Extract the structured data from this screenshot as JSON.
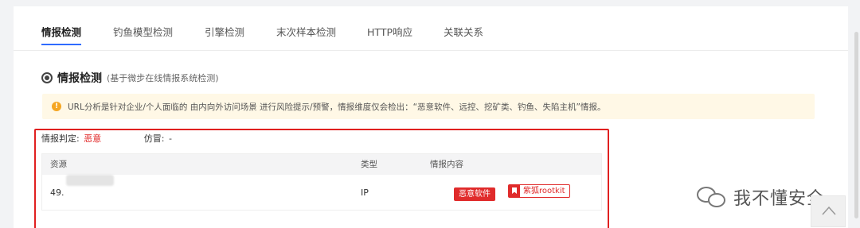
{
  "tabs": [
    "情报检测",
    "钓鱼模型检测",
    "引擎检测",
    "末次样本检测",
    "HTTP响应",
    "关联关系"
  ],
  "section": {
    "title": "情报检测",
    "subtitle": "(基于微步在线情报系统检测)"
  },
  "notice": {
    "icon": "info-icon",
    "text": "URL分析是针对企业/个人面临的 由内向外访问场景 进行风险提示/预警，情报维度仅会检出：“恶意软件、远控、挖矿类、钓鱼、失陷主机”情报。"
  },
  "verdict": {
    "label": "情报判定:",
    "value": "恶意",
    "fake_label": "仿冒:",
    "fake_value": "-"
  },
  "table": {
    "headers": [
      "资源",
      "类型",
      "情报内容"
    ],
    "rows": [
      {
        "resource": "49.",
        "type": "IP",
        "tags": [
          "恶意软件",
          "紫狐rootkit"
        ]
      }
    ]
  },
  "watermark": "我不懂安全",
  "colors": {
    "accent": "#2f6bff",
    "danger": "#e02020",
    "notice_bg": "#fff8e6"
  }
}
